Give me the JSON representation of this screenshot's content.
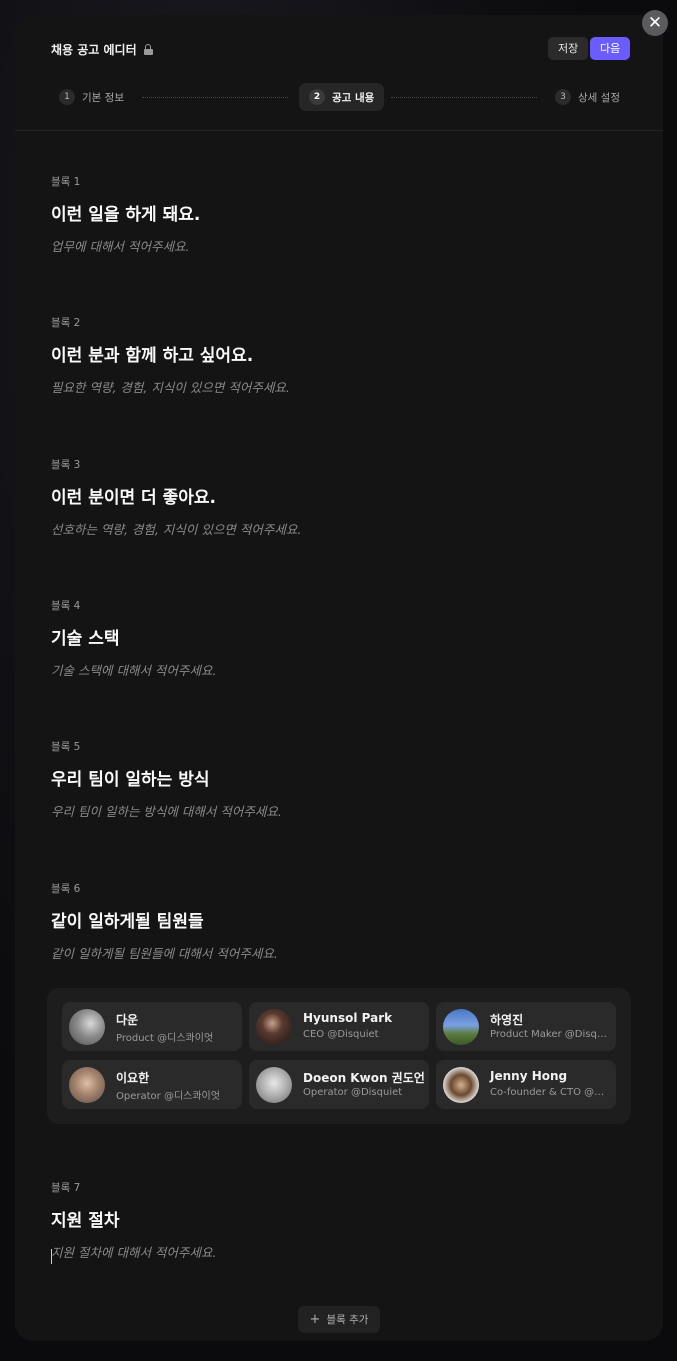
{
  "editor": {
    "title": "채용 공고 에디터",
    "save_label": "저장",
    "next_label": "다음",
    "close_symbol": "✕",
    "add_block_label": "블록 추가"
  },
  "steps": [
    {
      "num": "1",
      "label": "기본 정보"
    },
    {
      "num": "2",
      "label": "공고 내용"
    },
    {
      "num": "3",
      "label": "상세 설정"
    }
  ],
  "blocks": [
    {
      "label": "블록 1",
      "heading": "이런 일을 하게 돼요.",
      "placeholder": "업무에 대해서 적어주세요."
    },
    {
      "label": "블록 2",
      "heading": "이런 분과 함께 하고 싶어요.",
      "placeholder": "필요한 역량, 경험, 지식이 있으면 적어주세요."
    },
    {
      "label": "블록 3",
      "heading": "이런 분이면 더 좋아요.",
      "placeholder": "선호하는 역량, 경험, 지식이 있으면 적어주세요."
    },
    {
      "label": "블록 4",
      "heading": "기술 스택",
      "placeholder": "기술 스택에 대해서 적어주세요."
    },
    {
      "label": "블록 5",
      "heading": "우리 팀이 일하는 방식",
      "placeholder": "우리 팀이 일하는 방식에 대해서 적어주세요."
    },
    {
      "label": "블록 6",
      "heading": "같이 일하게될 팀원들",
      "placeholder": "같이 일하게될 팀원들에 대해서 적어주세요."
    },
    {
      "label": "블록 7",
      "heading": "지원 절차",
      "placeholder": "지원 절차에 대해서 적어주세요."
    }
  ],
  "team": [
    {
      "name": "다운",
      "role": "Product @디스콰이엇"
    },
    {
      "name": "Hyunsol Park",
      "role": "CEO @Disquiet"
    },
    {
      "name": "하영진",
      "role": "Product Maker @Disquiet"
    },
    {
      "name": "이요한",
      "role": "Operator @디스콰이엇"
    },
    {
      "name": "Doeon Kwon 권도언",
      "role": "Operator @Disquiet"
    },
    {
      "name": "Jenny Hong",
      "role": "Co-founder & CTO @Disquiet"
    }
  ],
  "colors": {
    "accent": "#6a5cff",
    "background": "#141414",
    "card": "#2a2a2a"
  }
}
